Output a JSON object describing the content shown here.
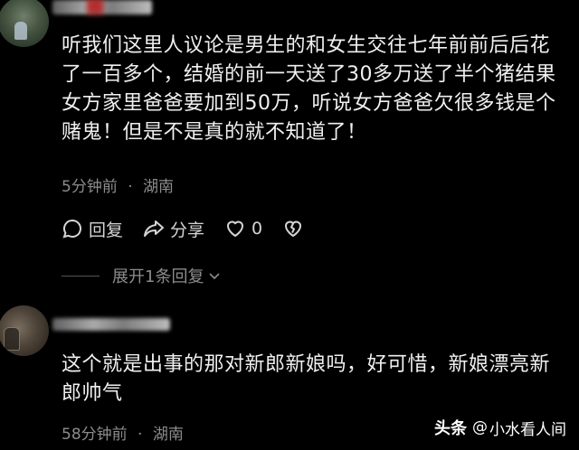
{
  "comments": [
    {
      "text": "听我们这里人议论是男生的和女生交往七年前前后后花了一百多个，结婚的前一天送了30多万送了半个猪结果女方家里爸爸要加到50万，听说女方爸爸欠很多钱是个赌鬼！但是不是真的就不知道了！",
      "time": "5分钟前",
      "separator": "·",
      "location": "湖南",
      "reply_label": "回复",
      "share_label": "分享",
      "like_count": "0",
      "expand_label": "展开1条回复"
    },
    {
      "text": "这个就是出事的那对新郎新娘吗，好可惜，新娘漂亮新郎帅气",
      "time": "58分钟前",
      "separator": "·",
      "location": "湖南"
    }
  ],
  "watermark": {
    "brand": "头条",
    "at": "@",
    "author": "小水看人间"
  },
  "icons": {
    "reply": "comment-bubble-icon",
    "share": "share-arrow-icon",
    "like": "heart-icon",
    "dislike": "broken-heart-icon",
    "expand": "chevron-down-icon"
  }
}
